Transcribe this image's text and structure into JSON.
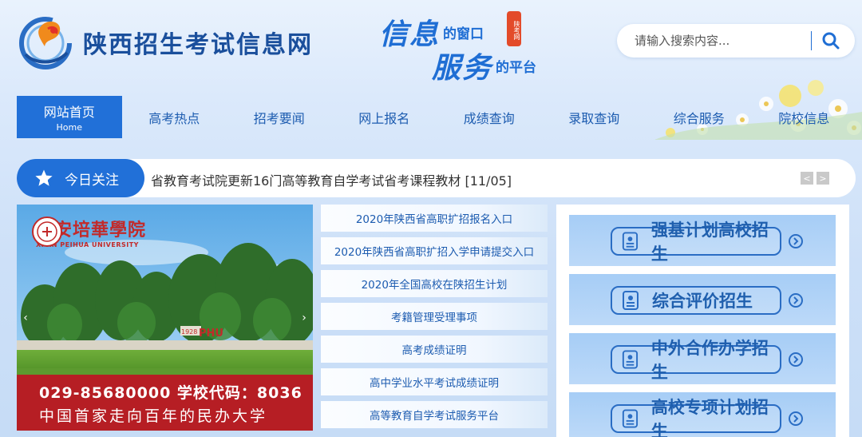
{
  "site": {
    "title": "陕西招生考试信息网"
  },
  "slogan": {
    "line1_big": "信息",
    "line1_small": "的窗口",
    "line2_big": "服务",
    "line2_small": "的平台",
    "seal": "陕考网"
  },
  "search": {
    "placeholder": "请输入搜索内容..."
  },
  "nav": {
    "items": [
      {
        "label": "网站首页",
        "sub": "Home"
      },
      {
        "label": "高考热点"
      },
      {
        "label": "招考要闻"
      },
      {
        "label": "网上报名"
      },
      {
        "label": "成绩查询"
      },
      {
        "label": "录取查询"
      },
      {
        "label": "综合服务"
      },
      {
        "label": "院校信息"
      }
    ]
  },
  "ticker": {
    "label": "今日关注",
    "text": "省教育考试院更新16门高等教育自学考试省考课程教材 [11/05]",
    "prev": "<",
    "next": ">"
  },
  "banner": {
    "school_cn": "西安培華學院",
    "school_en": "XI'AN PEIHUA UNIVERSITY",
    "phone_line": "029-85680000  学校代码：8036",
    "motto": "中国首家走向百年的民办大学",
    "sign": "1928 PHU",
    "prev": "‹",
    "next": "›"
  },
  "links": [
    "2020年陕西省高职扩招报名入口",
    "2020年陕西省高职扩招入学申请提交入口",
    "2020年全国高校在陕招生计划",
    "考籍管理受理事项",
    "高考成绩证明",
    "高中学业水平考试成绩证明",
    "高等教育自学考试服务平台"
  ],
  "panel": [
    "强基计划高校招生",
    "综合评价招生",
    "中外合作办学招生",
    "高校专项计划招生"
  ],
  "colors": {
    "primary": "#2170d8",
    "nav_text": "#1d5cb0",
    "banner_red": "#b61e24"
  }
}
